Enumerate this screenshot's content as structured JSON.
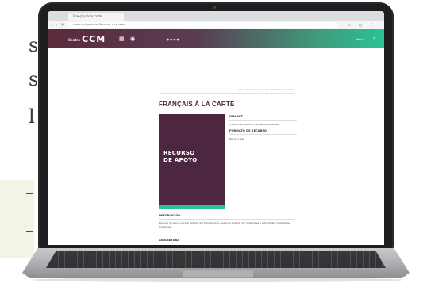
{
  "left_page": {
    "line1": "s",
    "line2": "s",
    "line3": "l"
  },
  "browser": {
    "tab_title": "Français à la carte",
    "url": "ccm.uc.cl/recursos/francais-a-la-carte",
    "nav_icons": [
      "back-icon",
      "forward-icon",
      "reload-icon"
    ]
  },
  "site": {
    "logo_small": "Centro",
    "logo": "CCM",
    "header_right": "Menú"
  },
  "page": {
    "breadcrumb": "Inicio / Recursos de apoyo / Français à la carte",
    "title": "FRANÇAIS À LA CARTE",
    "cover_line1": "RECURSO",
    "cover_line2": "DE APOYO",
    "info": {
      "h1": "DIALECT",
      "p1": "Francés del Québec (francés canadiense)",
      "h2": "FORMATO DE RECURSO",
      "p2": "Recurso web"
    },
    "description_heading": "DESCRIPCIÓN",
    "description_text": "Recurso de apoyo para el estudio del francés como segunda lengua, con materiales y actividades organizadas por temas.",
    "subjects_heading": "ASIGNATURA"
  },
  "colors": {
    "brand_plum": "#4d2740",
    "brand_green": "#2cc196",
    "laptop_bezel": "#1e1e20"
  }
}
